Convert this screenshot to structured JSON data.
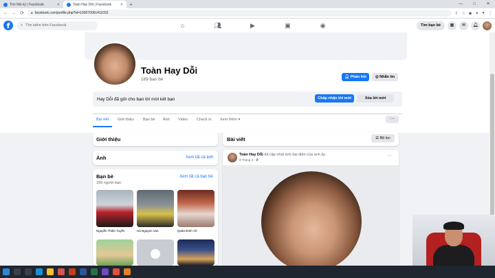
{
  "browser": {
    "tabs": [
      {
        "title": "Tìm Nhi ký | Facebook",
        "active": false
      },
      {
        "title": "Toàn Hay Dỗi | Facebook",
        "active": true
      }
    ],
    "new_tab": "+",
    "url": "facebook.com/profile.php?id=100070061411032"
  },
  "fb": {
    "logo": "f",
    "search_placeholder": "Tìm kiếm trên Facebook",
    "nav_icons": [
      "home-icon",
      "friends-icon",
      "watch-icon",
      "marketplace-icon",
      "groups-icon"
    ],
    "friends_button": "Tìm bạn bè"
  },
  "profile": {
    "name": "Toàn Hay Dỗi",
    "friend_count": "189 bạn bè",
    "reply_button": "Phản hồi",
    "message_button": "Nhắn tin",
    "request_text": "Hay Dỗi đã gửi cho bạn lời mời kết bạn",
    "accept_button": "Chấp nhận lời mời",
    "delete_button": "Xóa lời mời",
    "tabs": [
      "Bài viết",
      "Giới thiệu",
      "Bạn bè",
      "Ảnh",
      "Video",
      "Check in",
      "Xem thêm"
    ],
    "more": "···"
  },
  "left": {
    "intro_title": "Giới thiệu",
    "photos_title": "Ảnh",
    "photos_link": "Xem tất cả ảnh",
    "friends_title": "Bạn bè",
    "friends_link": "Xem tất cả bạn bè",
    "friends_count": "189 người bạn",
    "friends": [
      {
        "name": "Nguyễn Thiện Tuyền"
      },
      {
        "name": "Hà Nguyen Van"
      },
      {
        "name": "Quân Đình Vũ"
      }
    ]
  },
  "posts": {
    "title": "Bài viết",
    "filter_button": "Bộ lọc",
    "post": {
      "author": "Toàn Hay Dỗi",
      "action": "đã cập nhật ảnh đại diện của anh ấy.",
      "time": "9 Tháng 3 · ",
      "menu": "···"
    }
  }
}
